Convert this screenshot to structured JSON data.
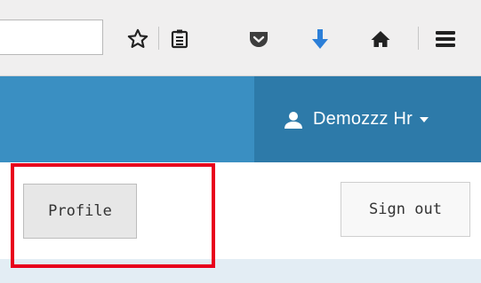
{
  "browser": {
    "url_value": "",
    "icons": [
      "star-icon",
      "reading-list-icon",
      "pocket-icon",
      "download-icon",
      "home-icon",
      "menu-icon"
    ],
    "download_color": "#2c7fd8"
  },
  "header": {
    "accent": "#3a8fc2",
    "user_menu_bg": "#2d7aa9",
    "user_name": "Demozzz Hr"
  },
  "actions": {
    "profile_label": "Profile",
    "signout_label": "Sign out"
  },
  "annotation": {
    "highlight_color": "#e8001c"
  }
}
